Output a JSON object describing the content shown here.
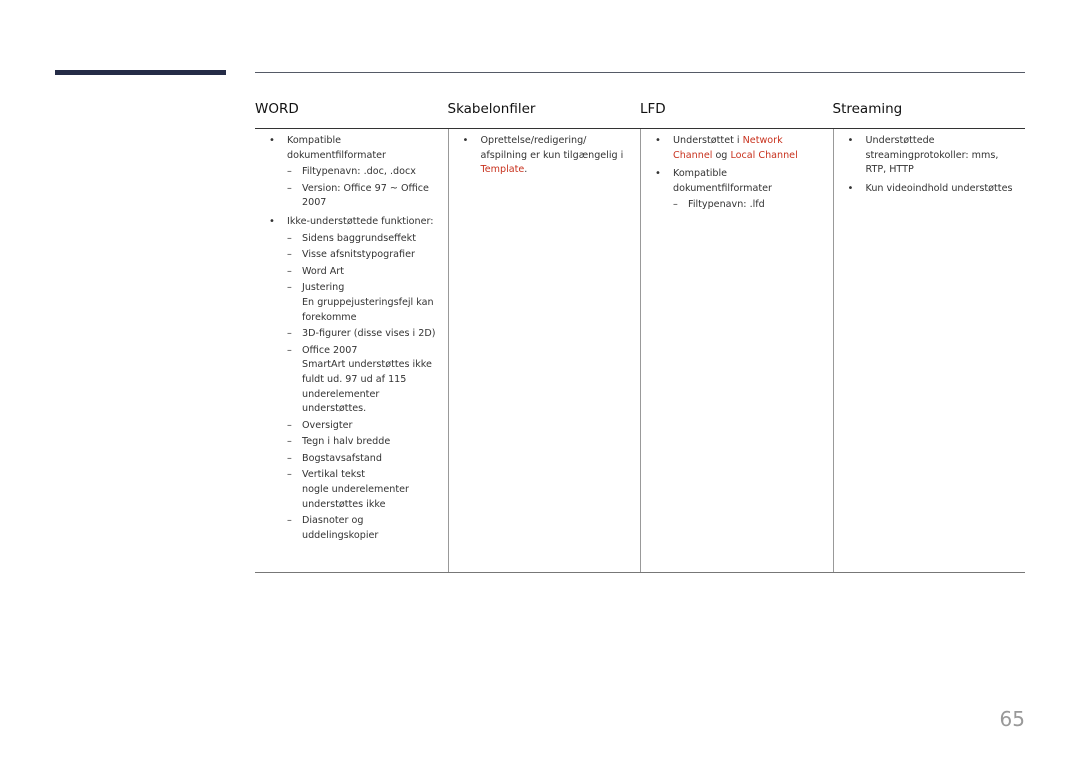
{
  "table": {
    "headers": [
      "WORD",
      "Skabelonfiler",
      "LFD",
      "Streaming"
    ],
    "word": {
      "compatible_label": "Kompatible dokumentfilformater",
      "compatible_items": [
        "Filtypenavn: .doc, .docx",
        "Version: Office 97 ~ Office 2007"
      ],
      "unsupported_label": "Ikke-understøttede funktioner:",
      "unsupported_items": [
        {
          "text": "Sidens baggrundseffekt",
          "note": ""
        },
        {
          "text": "Visse afsnitstypografier",
          "note": ""
        },
        {
          "text": "Word Art",
          "note": ""
        },
        {
          "text": "Justering",
          "note": "En gruppejusteringsfejl kan forekomme"
        },
        {
          "text": "3D-figurer (disse vises i 2D)",
          "note": ""
        },
        {
          "text": "Office 2007",
          "note": "SmartArt understøttes ikke fuldt ud. 97 ud af 115 underelementer understøttes."
        },
        {
          "text": "Oversigter",
          "note": ""
        },
        {
          "text": "Tegn i halv bredde",
          "note": ""
        },
        {
          "text": "Bogstavsafstand",
          "note": ""
        },
        {
          "text": "Vertikal tekst",
          "note": "nogle underelementer understøttes ikke"
        },
        {
          "text": "Diasnoter og uddelingskopier",
          "note": ""
        }
      ]
    },
    "template": {
      "text_before": "Oprettelse/redigering/ afspilning er kun tilgængelig i ",
      "link": "Template",
      "text_after": "."
    },
    "lfd": {
      "supported_prefix": "Understøttet i ",
      "link1": "Network Channel",
      "joiner": " og ",
      "link2": "Local Channel",
      "compatible_label": "Kompatible dokumentfilformater",
      "compatible_items": [
        "Filtypenavn: .lfd"
      ]
    },
    "streaming": {
      "items": [
        "Understøttede streamingprotokoller: mms, RTP, HTTP",
        "Kun videoindhold understøttes"
      ]
    }
  },
  "page_number": "65",
  "colors": {
    "accent_bar": "#252c47",
    "link": "#c8321e"
  }
}
